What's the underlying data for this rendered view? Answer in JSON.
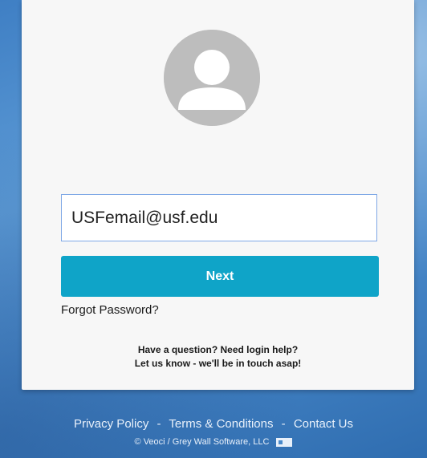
{
  "login": {
    "email_value": "USFemail@usf.edu",
    "next_label": "Next",
    "forgot_label": "Forgot Password?",
    "help_line1": "Have a question? Need login help?",
    "help_line2": "Let us know - we'll be in touch asap!"
  },
  "footer": {
    "privacy": "Privacy Policy",
    "terms": "Terms & Conditions",
    "contact": "Contact Us",
    "separator": "-",
    "copyright": "© Veoci / Grey Wall Software, LLC"
  },
  "icons": {
    "avatar": "user-avatar-icon",
    "language": "language-toggle-icon"
  },
  "colors": {
    "accent": "#0fa4c8",
    "card": "#f7f7f7",
    "avatar": "#bdbdbd"
  }
}
